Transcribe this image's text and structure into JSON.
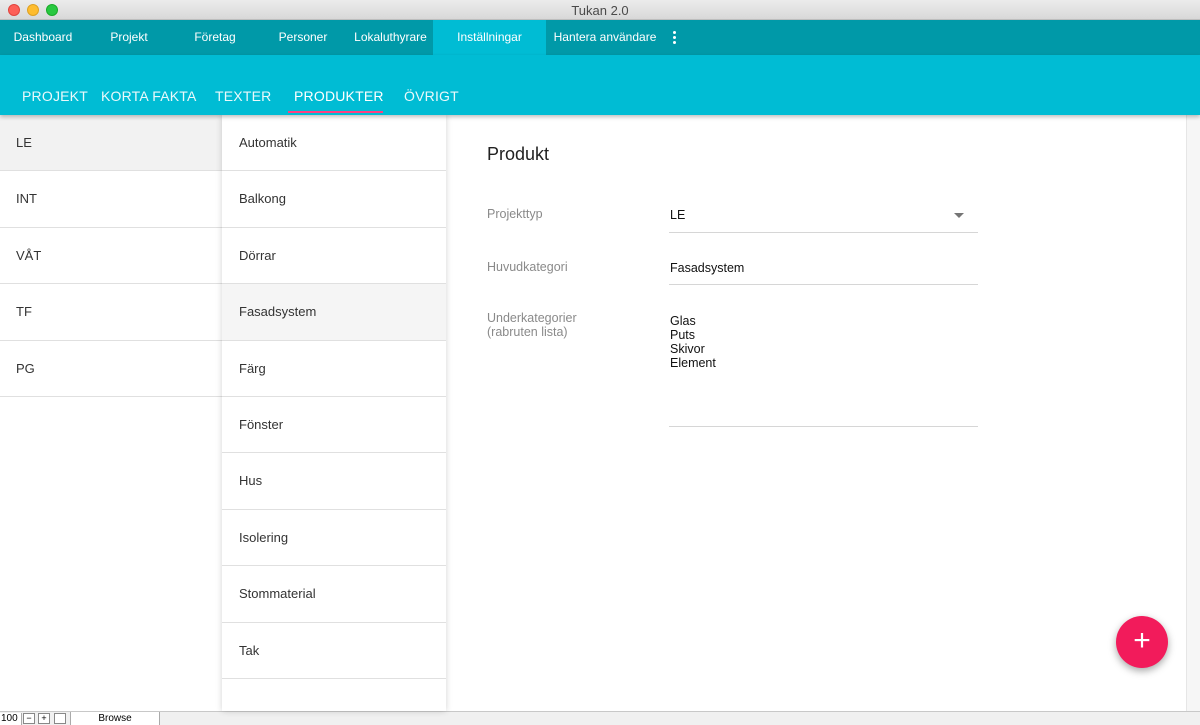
{
  "window": {
    "title": "Tukan 2.0"
  },
  "topnav": {
    "items": [
      {
        "label": "Dashboard"
      },
      {
        "label": "Projekt"
      },
      {
        "label": "Företag"
      },
      {
        "label": "Personer"
      },
      {
        "label": "Lokaluthyrare"
      },
      {
        "label": "Inställningar",
        "active": true
      },
      {
        "label": "Hantera användare"
      }
    ],
    "active_index": 5
  },
  "tabs": {
    "items": [
      {
        "label": "PROJEKT"
      },
      {
        "label": "KORTA FAKTA"
      },
      {
        "label": "TEXTER"
      },
      {
        "label": "PRODUKTER",
        "active": true
      },
      {
        "label": "ÖVRIGT"
      }
    ],
    "active_index": 3
  },
  "project_types": {
    "items": [
      {
        "label": "LE",
        "selected": true
      },
      {
        "label": "INT"
      },
      {
        "label": "VÅT"
      },
      {
        "label": "TF"
      },
      {
        "label": "PG"
      }
    ]
  },
  "categories": {
    "items": [
      {
        "label": "Automatik"
      },
      {
        "label": "Balkong"
      },
      {
        "label": "Dörrar"
      },
      {
        "label": "Fasadsystem",
        "selected": true
      },
      {
        "label": "Färg"
      },
      {
        "label": "Fönster"
      },
      {
        "label": "Hus"
      },
      {
        "label": "Isolering"
      },
      {
        "label": "Stommaterial"
      },
      {
        "label": "Tak"
      },
      {
        "label": ""
      }
    ]
  },
  "form": {
    "title": "Produkt",
    "projekttyp": {
      "label": "Projekttyp",
      "value": "LE"
    },
    "huvudkategori": {
      "label": "Huvudkategori",
      "value": "Fasadsystem"
    },
    "underkategorier": {
      "label_line1": "Underkategorier",
      "label_line2": "(rabruten lista)",
      "values": [
        "Glas",
        "Puts",
        "Skivor",
        "Element"
      ]
    }
  },
  "fab": {
    "symbol": "+"
  },
  "statusbar": {
    "zoom": "100",
    "browse_label": "Browse"
  },
  "colors": {
    "topnav_bg": "#0099a8",
    "accent_cyan": "#00bcd4",
    "tab_indicator": "#ff4081",
    "fab": "#f21b5b"
  }
}
